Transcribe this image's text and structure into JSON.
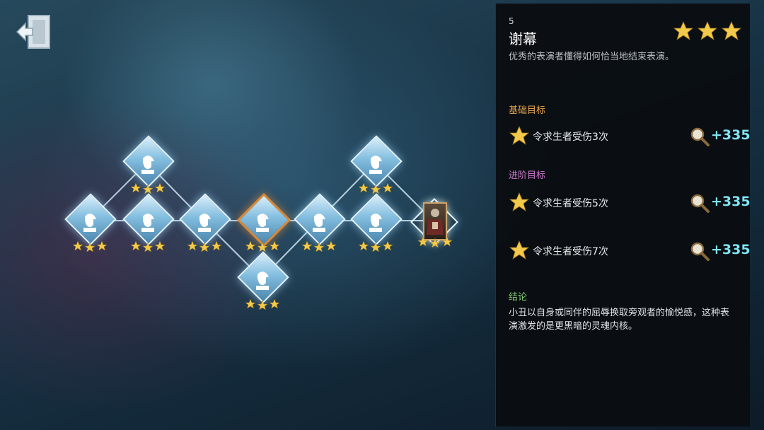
{
  "level": {
    "number": "5",
    "title": "谢幕",
    "description": "优秀的表演者懂得如何恰当地结束表演。",
    "stars": 3
  },
  "basic_goal": {
    "heading": "基础目标",
    "objectives": [
      {
        "text": "令求生者受伤3次",
        "reward": "+335",
        "icon": "magnifier-icon"
      }
    ]
  },
  "advanced_goal": {
    "heading": "进阶目标",
    "objectives": [
      {
        "text": "令求生者受伤5次",
        "reward": "+335",
        "icon": "magnifier-icon"
      },
      {
        "text": "令求生者受伤7次",
        "reward": "+335",
        "icon": "magnifier-icon"
      }
    ]
  },
  "conclusion": {
    "heading": "结论",
    "text": "小丑以自身或同伴的屈辱换取旁观者的愉悦感，这种表演激发的是更黑暗的灵魂内核。"
  },
  "map": {
    "nodes": [
      {
        "id": "n1",
        "stars": 3,
        "type": "sherlock"
      },
      {
        "id": "n2",
        "stars": 3,
        "type": "sherlock"
      },
      {
        "id": "n3",
        "stars": 3,
        "type": "sherlock"
      },
      {
        "id": "n4",
        "stars": 3,
        "type": "sherlock"
      },
      {
        "id": "n5",
        "stars": 3,
        "type": "sherlock",
        "selected": true
      },
      {
        "id": "n6",
        "stars": 3,
        "type": "sherlock"
      },
      {
        "id": "n7",
        "stars": 3,
        "type": "sherlock"
      },
      {
        "id": "n8",
        "stars": 3,
        "type": "sherlock"
      },
      {
        "id": "n9",
        "stars": 3,
        "type": "sherlock"
      },
      {
        "id": "n10",
        "stars": 3,
        "type": "portrait"
      }
    ]
  },
  "icons": {
    "exit": "exit-door-icon",
    "star": "star-icon",
    "reward": "magnifier-icon"
  },
  "colors": {
    "basic_heading": "#e9a64e",
    "advanced_heading": "#d17ad0",
    "conclusion_heading": "#7cc86a",
    "reward_text": "#7fe3f3",
    "star": "#f3c94a",
    "selected_border": "#d88a3a"
  }
}
